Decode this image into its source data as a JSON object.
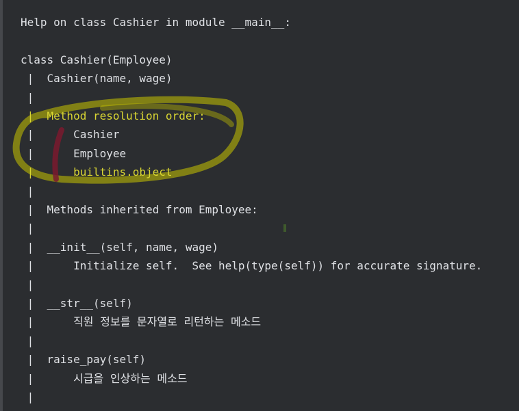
{
  "colors": {
    "background": "#2b2d30",
    "text": "#dfe1e5",
    "highlight_text": "#d9d633",
    "highlight_circle": "#c8c400",
    "marker": "#7a1a2e"
  },
  "console": {
    "lines": [
      {
        "text": "Help on class Cashier in module __main__:",
        "highlight": false
      },
      {
        "text": "",
        "highlight": false
      },
      {
        "text": "class Cashier(Employee)",
        "highlight": false
      },
      {
        "text": " |  Cashier(name, wage)",
        "highlight": false
      },
      {
        "text": " |",
        "highlight": false
      },
      {
        "text": " |  Method resolution order:",
        "highlight": true
      },
      {
        "text": " |      Cashier",
        "highlight": false
      },
      {
        "text": " |      Employee",
        "highlight": false
      },
      {
        "text": " |      builtins.object",
        "highlight": true
      },
      {
        "text": " |",
        "highlight": false
      },
      {
        "text": " |  Methods inherited from Employee:",
        "highlight": false
      },
      {
        "text": " |",
        "highlight": false
      },
      {
        "text": " |  __init__(self, name, wage)",
        "highlight": false
      },
      {
        "text": " |      Initialize self.  See help(type(self)) for accurate signature.",
        "highlight": false
      },
      {
        "text": " |",
        "highlight": false
      },
      {
        "text": " |  __str__(self)",
        "highlight": false
      },
      {
        "text": " |      직원 정보를 문자열로 리턴하는 메소드",
        "highlight": false
      },
      {
        "text": " |",
        "highlight": false
      },
      {
        "text": " |  raise_pay(self)",
        "highlight": false
      },
      {
        "text": " |      시급을 인상하는 메소드",
        "highlight": false
      },
      {
        "text": " |",
        "highlight": false
      }
    ]
  }
}
